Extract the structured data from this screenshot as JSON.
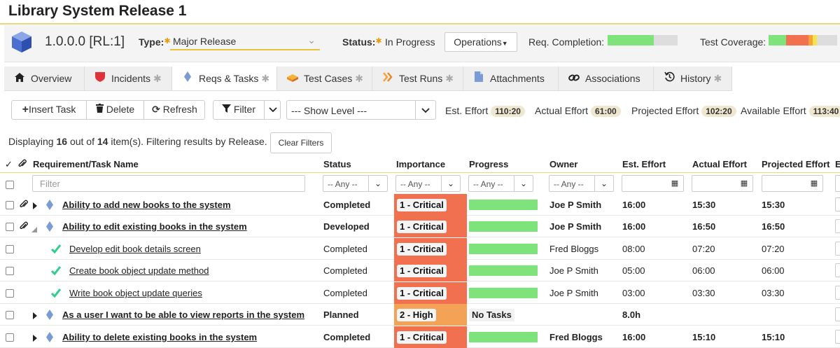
{
  "page_title": "Library System Release 1",
  "release": {
    "version": "1.0.0.0 [RL:1]",
    "type_label": "Type:",
    "type_value": "Major Release",
    "status_label": "Status:",
    "status_value": "In Progress",
    "operations_label": "Operations",
    "req_completion_label": "Req. Completion:",
    "req_completion_fraction": 0.66,
    "test_coverage_label": "Test Coverage:",
    "test_coverage_segments": [
      {
        "color": "#7de37a",
        "fraction": 0.25
      },
      {
        "color": "#f07050",
        "fraction": 0.33
      },
      {
        "color": "#f7a23a",
        "fraction": 0.06
      },
      {
        "color": "#f5e34a",
        "fraction": 0.06
      },
      {
        "color": "#dddddd",
        "fraction": 0.3
      }
    ]
  },
  "tabs": [
    {
      "label": "Overview",
      "icon": "home-icon",
      "asterisk": ""
    },
    {
      "label": "Incidents",
      "icon": "shield-icon",
      "asterisk": "✱"
    },
    {
      "label": "Reqs & Tasks",
      "icon": "diamond-icon",
      "asterisk": "✱"
    },
    {
      "label": "Test Cases",
      "icon": "test-case-icon",
      "asterisk": "✱"
    },
    {
      "label": "Test Runs",
      "icon": "test-run-icon",
      "asterisk": "✱"
    },
    {
      "label": "Attachments",
      "icon": "document-icon",
      "asterisk": ""
    },
    {
      "label": "Associations",
      "icon": "link-icon",
      "asterisk": ""
    },
    {
      "label": "History",
      "icon": "history-icon",
      "asterisk": "✱"
    }
  ],
  "toolbar": {
    "insert_task": "Insert Task",
    "delete": "Delete",
    "refresh": "Refresh",
    "filter": "Filter",
    "show_level": "--- Show Level ---",
    "est_effort_label": "Est. Effort",
    "est_effort_value": "110:20",
    "actual_effort_label": "Actual Effort",
    "actual_effort_value": "61:00",
    "projected_effort_label": "Projected Effort",
    "projected_effort_value": "102:20",
    "available_effort_label": "Available Effort",
    "available_effort_value": "113:40"
  },
  "display": {
    "prefix": "Displaying ",
    "shown": "16",
    "middle": " out of ",
    "total": "14",
    "suffix": " item(s). Filtering results by Release.",
    "clear_filters": "Clear Filters"
  },
  "columns": {
    "name": "Requirement/Task Name",
    "status": "Status",
    "importance": "Importance",
    "progress": "Progress",
    "owner": "Owner",
    "est_effort": "Est. Effort",
    "actual_effort": "Actual Effort",
    "projected_effort": "Projected Effort",
    "edge": "E"
  },
  "filters": {
    "name_placeholder": "Filter",
    "any": "-- Any --"
  },
  "colors": {
    "critical": "#f07050",
    "high": "#f4a256",
    "progress_green": "#7de37a",
    "accent_yellow": "#e8d87a"
  },
  "rows": [
    {
      "name": "Ability to add new books to the system",
      "status": "Completed",
      "importance": "1 - Critical",
      "progress_fraction": 1.0,
      "progress_text": "",
      "owner": "Joe P Smith",
      "est": "16:00",
      "actual": "15:30",
      "projected": "15:30"
    },
    {
      "name": "Ability to edit existing books in the system",
      "status": "Developed",
      "importance": "1 - Critical",
      "progress_fraction": 1.0,
      "progress_text": "",
      "owner": "Joe P Smith",
      "est": "16:00",
      "actual": "16:50",
      "projected": "16:50"
    },
    {
      "name": "Develop edit book details screen",
      "status": "Completed",
      "importance": "1 - Critical",
      "progress_fraction": 1.0,
      "progress_text": "",
      "owner": "Fred Bloggs",
      "est": "08:00",
      "actual": "07:20",
      "projected": "07:20"
    },
    {
      "name": "Create book object update method",
      "status": "Completed",
      "importance": "1 - Critical",
      "progress_fraction": 1.0,
      "progress_text": "",
      "owner": "Joe P Smith",
      "est": "05:00",
      "actual": "06:00",
      "projected": "06:00"
    },
    {
      "name": "Write book object update queries",
      "status": "Completed",
      "importance": "1 - Critical",
      "progress_fraction": 1.0,
      "progress_text": "",
      "owner": "Joe P Smith",
      "est": "03:00",
      "actual": "03:30",
      "projected": "03:30"
    },
    {
      "name": "As a user I want to be able to view reports in the system",
      "status": "Planned",
      "importance": "2 - High",
      "progress_fraction": 0,
      "progress_text": "No Tasks",
      "owner": "",
      "est": "8.0h",
      "actual": "",
      "projected": ""
    },
    {
      "name": "Ability to delete existing books in the system",
      "status": "Completed",
      "importance": "1 - Critical",
      "progress_fraction": 1.0,
      "progress_text": "",
      "owner": "Fred Bloggs",
      "est": "16:00",
      "actual": "15:10",
      "projected": "15:10"
    }
  ]
}
